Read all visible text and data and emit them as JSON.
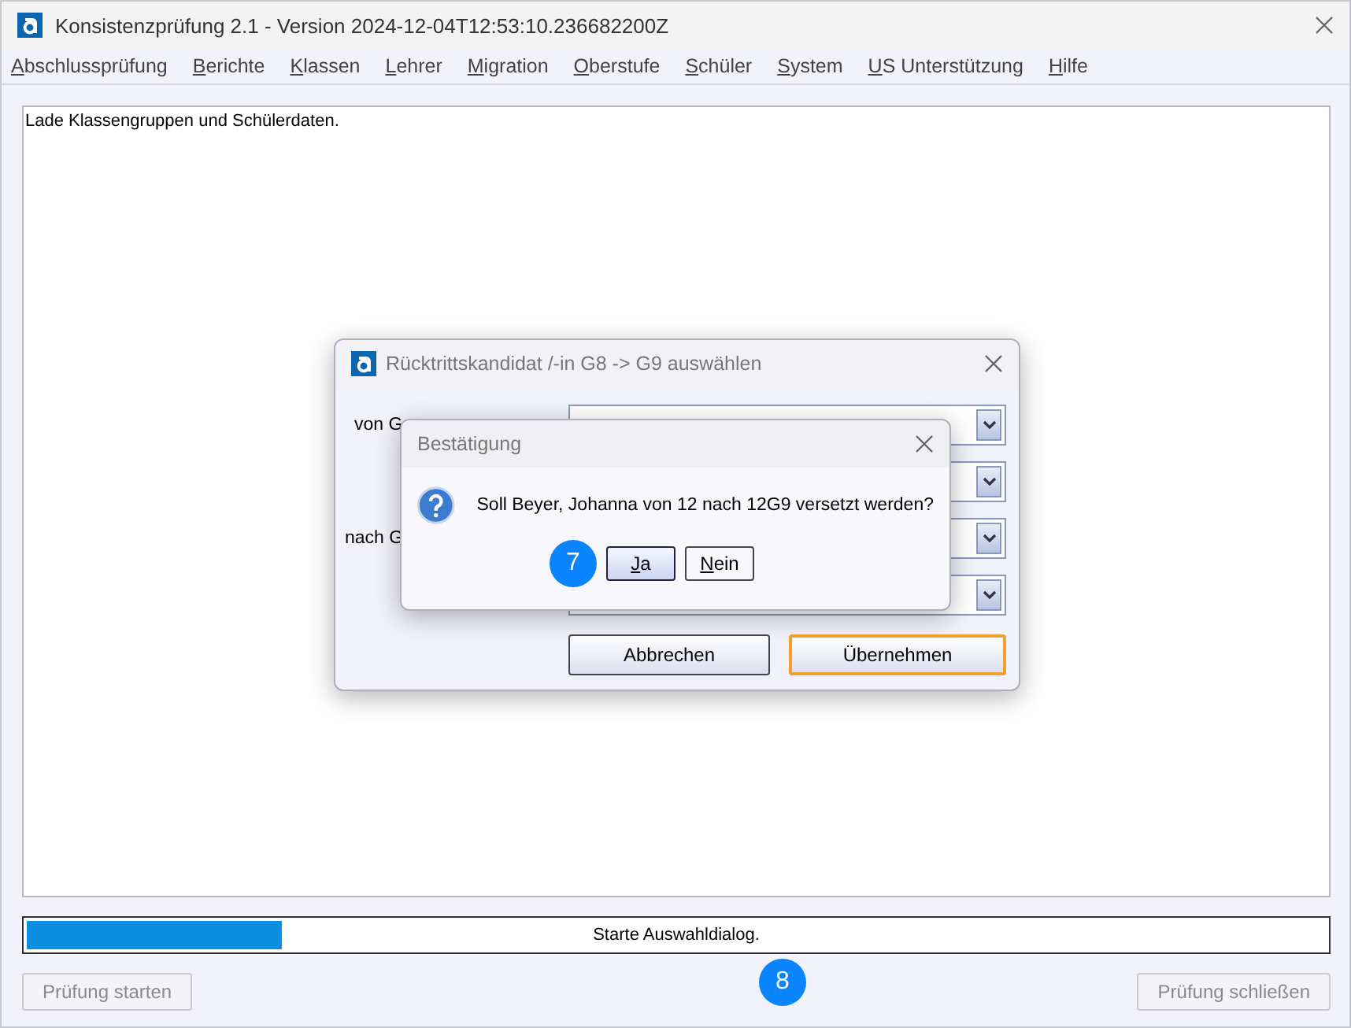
{
  "window": {
    "title": "Konsistenzprüfung 2.1 - Version 2024-12-04T12:53:10.236682200Z"
  },
  "menu": [
    "Abschlussprüfung",
    "Berichte",
    "Klassen",
    "Lehrer",
    "Migration",
    "Oberstufe",
    "Schüler",
    "System",
    "US Unterstützung",
    "Hilfe"
  ],
  "log": [
    "Lade Klassengruppen und Schülerdaten."
  ],
  "progress": {
    "level": 0.2,
    "text": "Starte Auswahldialog."
  },
  "buttons": [
    {
      "label": "Prüfung starten",
      "disabled": true
    },
    {
      "label": "Prüfung schließen",
      "disabled": true
    }
  ],
  "step_badges": [
    "7",
    "8"
  ],
  "dialog": {
    "title": "Rücktrittskandidat /-in G8 -> G9 auswählen",
    "labels": [
      "von G",
      "nach G"
    ],
    "buttons": [
      {
        "label": "Abbrechen",
        "default": false
      },
      {
        "label": "Übernehmen",
        "default": true
      }
    ]
  },
  "confirm": {
    "title": "Bestätigung",
    "message": "Soll Beyer, Johanna von 12 nach 12G9 versetzt werden?",
    "buttons": [
      {
        "label": "Ja",
        "focused": true
      },
      {
        "label": "Nein",
        "focused": false
      }
    ]
  }
}
